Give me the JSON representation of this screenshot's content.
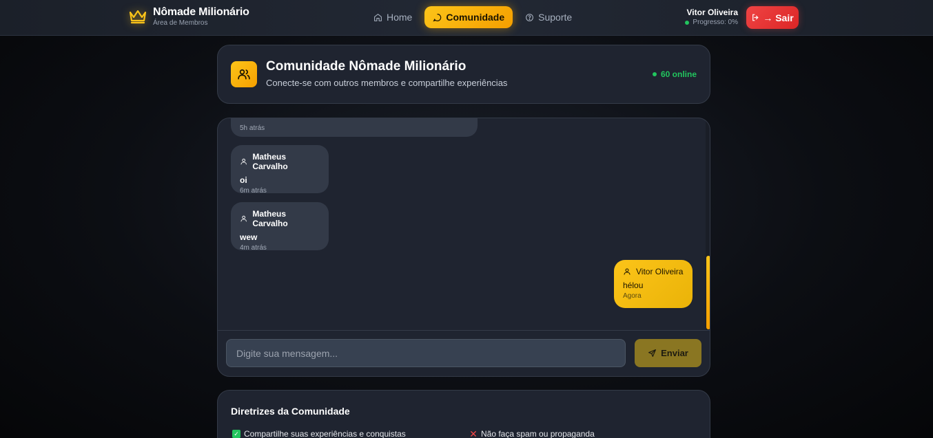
{
  "brand": {
    "title": "Nômade Milionário",
    "subtitle": "Área de Membros",
    "icon": "crown-icon"
  },
  "nav": {
    "home": "Home",
    "community": "Comunidade",
    "support": "Suporte"
  },
  "user": {
    "name": "Vitor Oliveira",
    "progress": "Progresso: 0%"
  },
  "logout_label": "→ Sair",
  "community": {
    "title": "Comunidade Nômade Milionário",
    "subtitle": "Conecte-se com outros membros e compartilhe experiências",
    "online": "60 online"
  },
  "messages": [
    {
      "time": "5h atrás"
    },
    {
      "author": "Matheus Carvalho",
      "text": "oi",
      "time": "6m atrás"
    },
    {
      "author": "Matheus Carvalho",
      "text": "wew",
      "time": "4m atrás"
    },
    {
      "author": "Vitor Oliveira",
      "text": "hélou",
      "time": "Agora"
    }
  ],
  "composer": {
    "placeholder": "Digite sua mensagem...",
    "send": "Enviar"
  },
  "guidelines": {
    "title": "Diretrizes da Comunidade",
    "items": [
      "Compartilhe suas experiências e conquistas",
      "Não faça spam ou propaganda"
    ]
  },
  "colors": {
    "accent": "#fcc419",
    "danger": "#ef4444",
    "online": "#22c55e"
  }
}
